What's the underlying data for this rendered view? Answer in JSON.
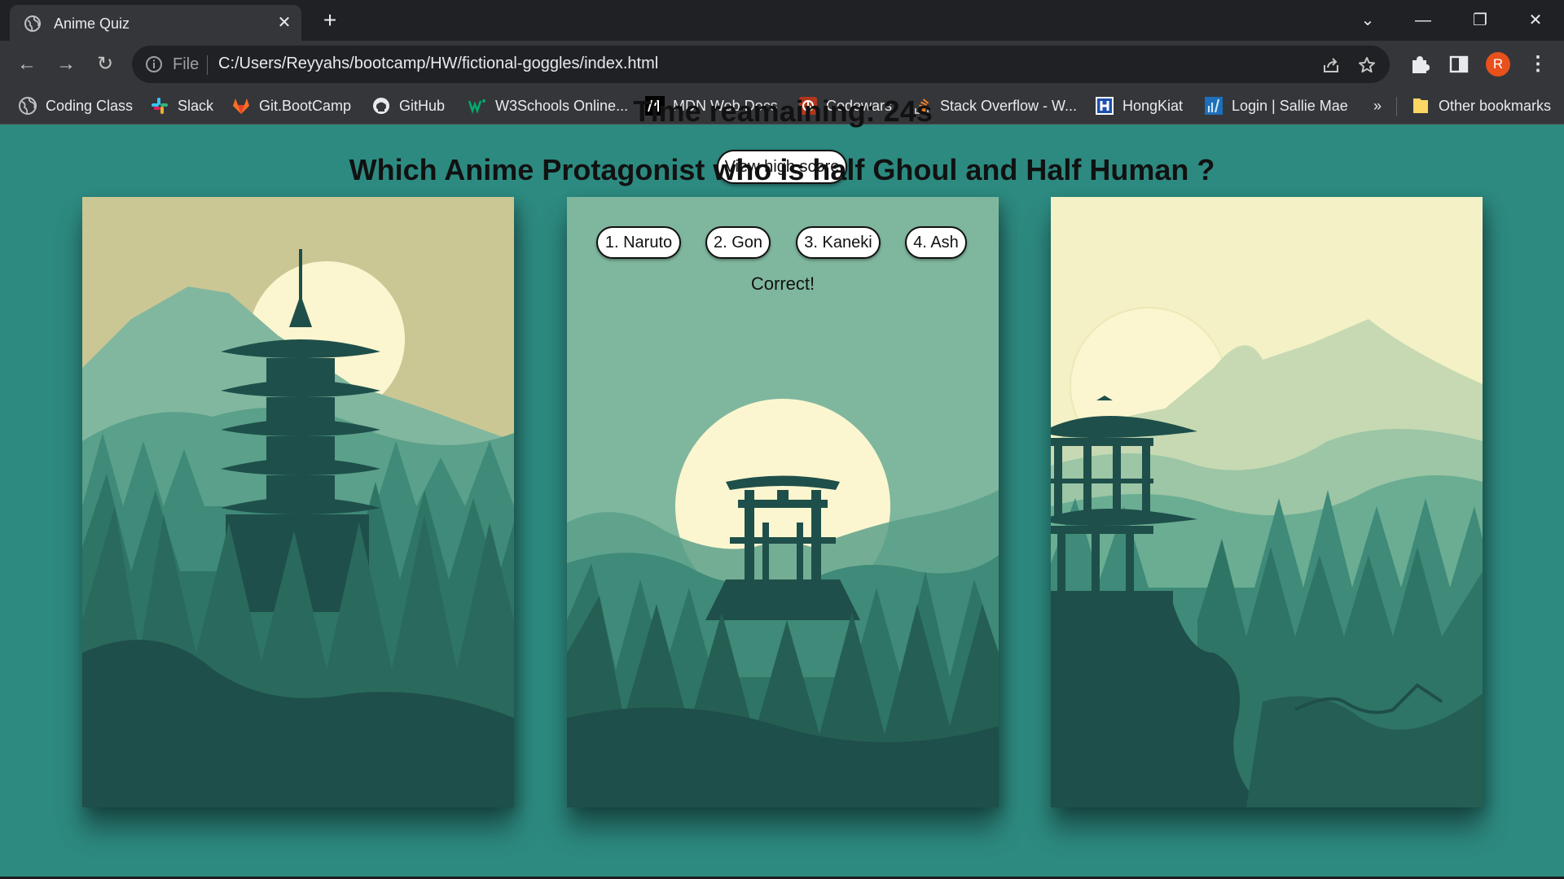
{
  "browser": {
    "tab_title": "Anime Quiz",
    "url_scheme": "File",
    "url": "C:/Users/Reyyahs/bootcamp/HW/fictional-goggles/index.html",
    "profile_initial": "R",
    "bookmarks": [
      {
        "label": "Coding Class",
        "icon": "globe-icon"
      },
      {
        "label": "Slack",
        "icon": "slack-icon"
      },
      {
        "label": "Git.BootCamp",
        "icon": "gitlab-icon"
      },
      {
        "label": "GitHub",
        "icon": "github-icon"
      },
      {
        "label": "W3Schools Online...",
        "icon": "w3schools-icon"
      },
      {
        "label": "MDN Web Docs",
        "icon": "mdn-icon"
      },
      {
        "label": "Codewars",
        "icon": "codewars-icon"
      },
      {
        "label": "Stack Overflow - W...",
        "icon": "stackoverflow-icon"
      },
      {
        "label": "HongKiat",
        "icon": "hongkiat-icon"
      },
      {
        "label": "Login | Sallie Mae",
        "icon": "salliemae-icon"
      }
    ],
    "more_bookmarks": "»",
    "other_bookmarks": "Other bookmarks"
  },
  "quiz": {
    "high_score_label": "View high score",
    "timer_text": "Time reamaining: 24s",
    "question": "Which Anime Protagonist who is half Ghoul and Half Human ?",
    "answers": [
      "1. Naruto",
      "2. Gon",
      "3. Kaneki",
      "4. Ash"
    ],
    "feedback": "Correct!"
  },
  "colors": {
    "page_background": "#2d8a80",
    "panel_dark": "#1f4f4a",
    "panel_mid": "#3f8a78",
    "panel_light": "#7fb79e",
    "sun": "#fbf6cf",
    "avatar": "#e8501c"
  }
}
